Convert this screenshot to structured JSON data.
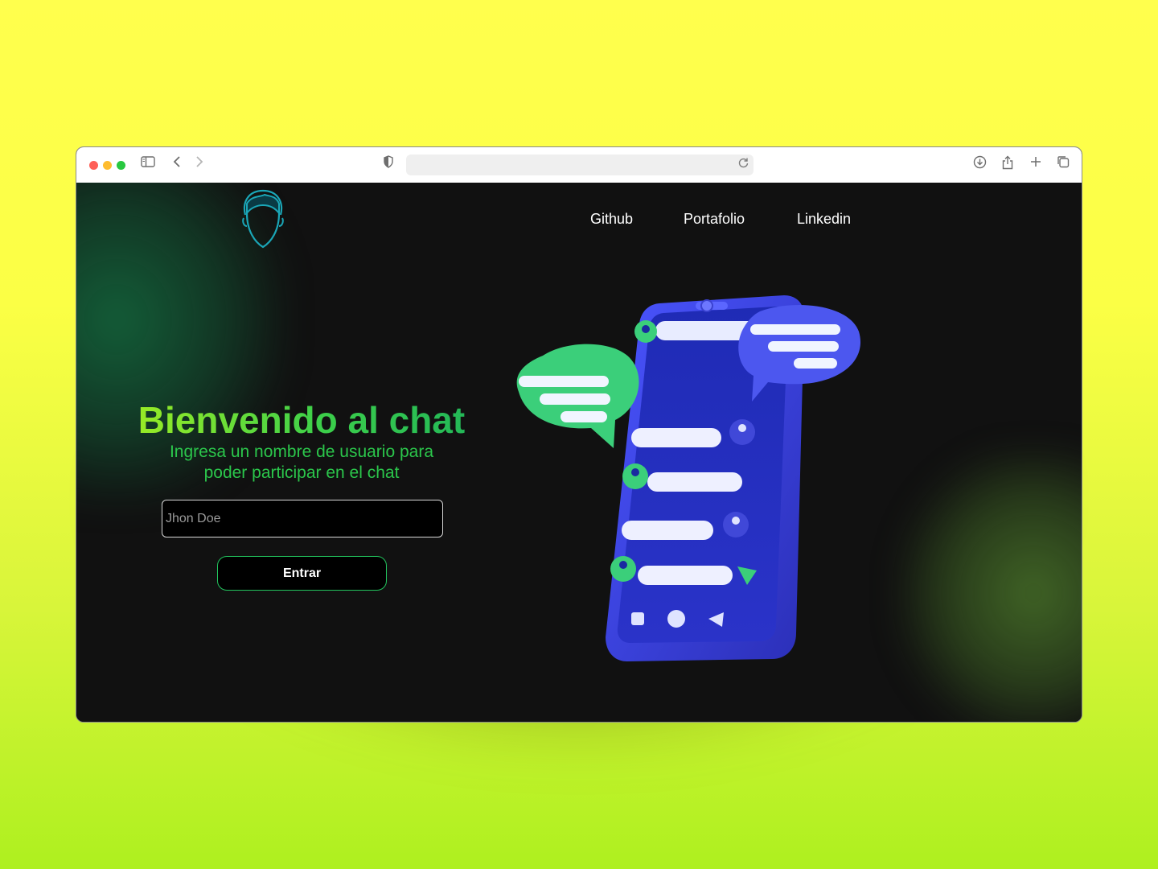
{
  "browser": {
    "icons": [
      "sidebar-icon",
      "back-icon",
      "forward-icon",
      "shield-icon",
      "reload-icon",
      "download-icon",
      "share-icon",
      "new-tab-icon",
      "tabs-overview-icon"
    ]
  },
  "nav": {
    "links": [
      "Github",
      "Portafolio",
      "Linkedin"
    ]
  },
  "hero": {
    "title": "Bienvenido al chat",
    "subtitle_line1": "Ingresa un nombre de usuario para",
    "subtitle_line2": "poder participar en el chat"
  },
  "form": {
    "username_placeholder": "Jhon Doe",
    "submit_label": "Entrar"
  },
  "colors": {
    "page_background": "#111111",
    "accent_green": "#22c55e",
    "phone_blue": "#3b3fd6"
  }
}
